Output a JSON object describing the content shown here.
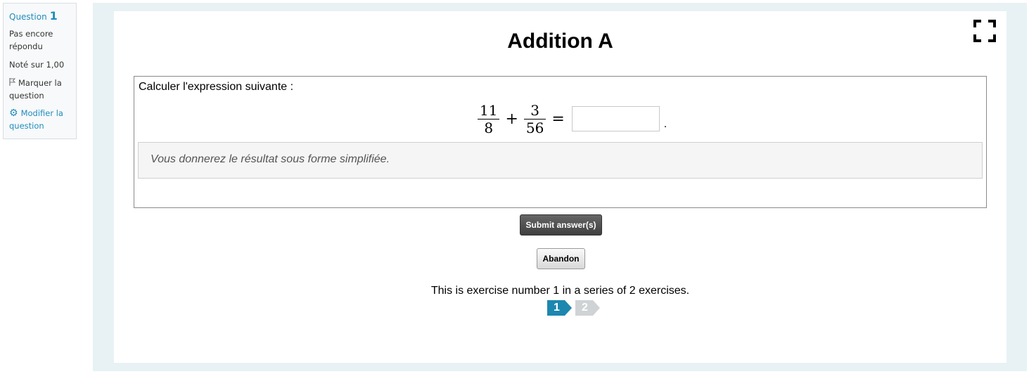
{
  "sidebar": {
    "question_label": "Question",
    "question_number": "1",
    "state": "Pas encore répondu",
    "grade": "Noté sur 1,00",
    "flag_label": "Marquer la question",
    "edit_label": "Modifier la question"
  },
  "exercise": {
    "title": "Addition A",
    "prompt": "Calculer l'expression suivante :",
    "expression": {
      "frac1_num": "11",
      "frac1_den": "8",
      "operator": "+",
      "frac2_num": "3",
      "frac2_den": "56",
      "equals": "=",
      "answer_value": "",
      "trailing": "."
    },
    "hint": "Vous donnerez le résultat sous forme simplifiée.",
    "submit_label": "Submit answer(s)",
    "abandon_label": "Abandon",
    "series_text": "This is exercise number 1 in a series of 2 exercises.",
    "pages": [
      "1",
      "2"
    ],
    "current_page": "1"
  },
  "colors": {
    "accent": "#1f8dbd",
    "panel_bg": "#e8f2f5",
    "page_active": "#1d87b0",
    "page_inactive": "#cfd3d5"
  },
  "icons": {
    "fullscreen": "fullscreen-icon",
    "flag": "flag-icon",
    "gear": "gear-icon"
  }
}
